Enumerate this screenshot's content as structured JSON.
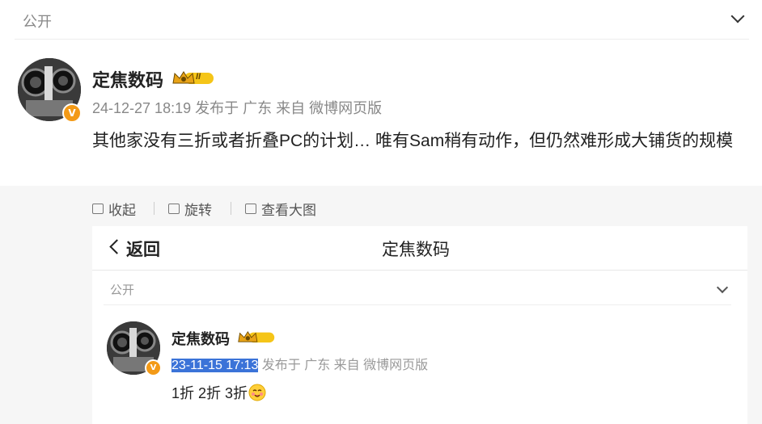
{
  "visibility": {
    "label": "公开"
  },
  "post": {
    "author": "定焦数码",
    "meta": "24-12-27 18:19 发布于 广东 来自 微博网页版",
    "text": "其他家没有三折或者折叠PC的计划… 唯有Sam稍有动作，但仍然难形成大铺货的规模"
  },
  "image_actions": {
    "collapse": "收起",
    "rotate": "旋转",
    "view_large": "查看大图"
  },
  "embedded": {
    "nav": {
      "back": "返回",
      "title": "定焦数码"
    },
    "visibility": "公开",
    "author": "定焦数码",
    "date_selected": "23-11-15 17:13",
    "meta_rest": " 发布于 广东 来自 微博网页版",
    "text": "1折 2折 3折"
  },
  "badges": {
    "vip_level": "II",
    "verified": "V"
  },
  "colors": {
    "accent_orange": "#f39a17",
    "selection_blue": "#3b73d8",
    "crown_gold": "#f5c518"
  },
  "icons": [
    "chevron-down-icon",
    "crown-icon",
    "verified-v-icon",
    "collapse-icon",
    "rotate-icon",
    "view-large-icon",
    "chevron-left-icon",
    "emoji-face-icon"
  ]
}
